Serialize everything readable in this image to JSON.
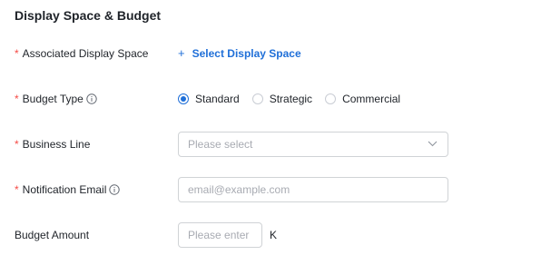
{
  "section": {
    "title": "Display Space & Budget"
  },
  "form": {
    "required_marker": "*",
    "display_space": {
      "label": "Associated Display Space",
      "button_icon": "+",
      "button_label": "Select Display Space"
    },
    "budget_type": {
      "label": "Budget Type",
      "info_icon": "info-circle-icon",
      "options": [
        {
          "label": "Standard",
          "selected": true
        },
        {
          "label": "Strategic",
          "selected": false
        },
        {
          "label": "Commercial",
          "selected": false
        }
      ]
    },
    "business_line": {
      "label": "Business Line",
      "placeholder": "Please select",
      "icon": "chevron-down-icon"
    },
    "notification_email": {
      "label": "Notification Email",
      "info_icon": "info-circle-icon",
      "placeholder": "email@example.com"
    },
    "budget_amount": {
      "label": "Budget Amount",
      "placeholder": "Please enter",
      "unit": "K"
    }
  },
  "colors": {
    "accent": "#1f6fd8",
    "required": "#f54a45",
    "border": "#d0d3d6",
    "placeholder": "#a8abb2"
  }
}
